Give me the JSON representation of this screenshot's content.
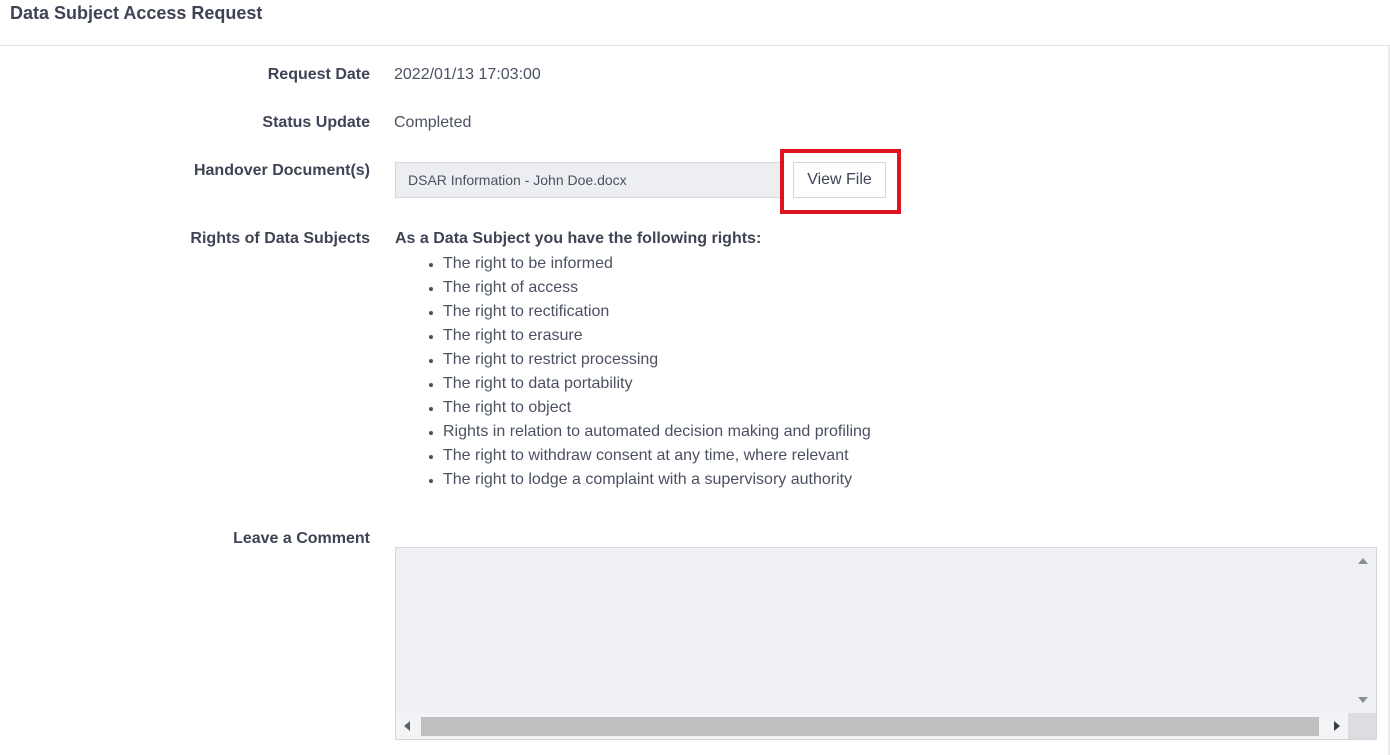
{
  "header": {
    "title": "Data Subject Access Request"
  },
  "fields": {
    "request_date": {
      "label": "Request Date",
      "value": "2022/01/13 17:03:00"
    },
    "status_update": {
      "label": "Status Update",
      "value": "Completed"
    },
    "handover": {
      "label": "Handover Document(s)",
      "file_name": "DSAR Information - John Doe.docx",
      "view_button": "View File"
    },
    "rights": {
      "label": "Rights of Data Subjects",
      "heading": "As a Data Subject you have the following rights:",
      "items": [
        "The right to be informed",
        "The right of access",
        "The right to rectification",
        "The right to erasure",
        "The right to restrict processing",
        "The right to data portability",
        "The right to object",
        "Rights in relation to automated decision making and profiling",
        "The right to withdraw consent at any time, where relevant",
        "The right to lodge a complaint with a supervisory authority"
      ]
    },
    "comment": {
      "label": "Leave a Comment",
      "value": ""
    }
  },
  "colors": {
    "highlight": "#e0141e",
    "input_bg": "#eceef1",
    "label_text": "#3e4454"
  },
  "icons": [
    "scroll-up-arrow-icon",
    "scroll-down-arrow-icon",
    "scroll-left-arrow-icon",
    "scroll-right-arrow-icon"
  ]
}
